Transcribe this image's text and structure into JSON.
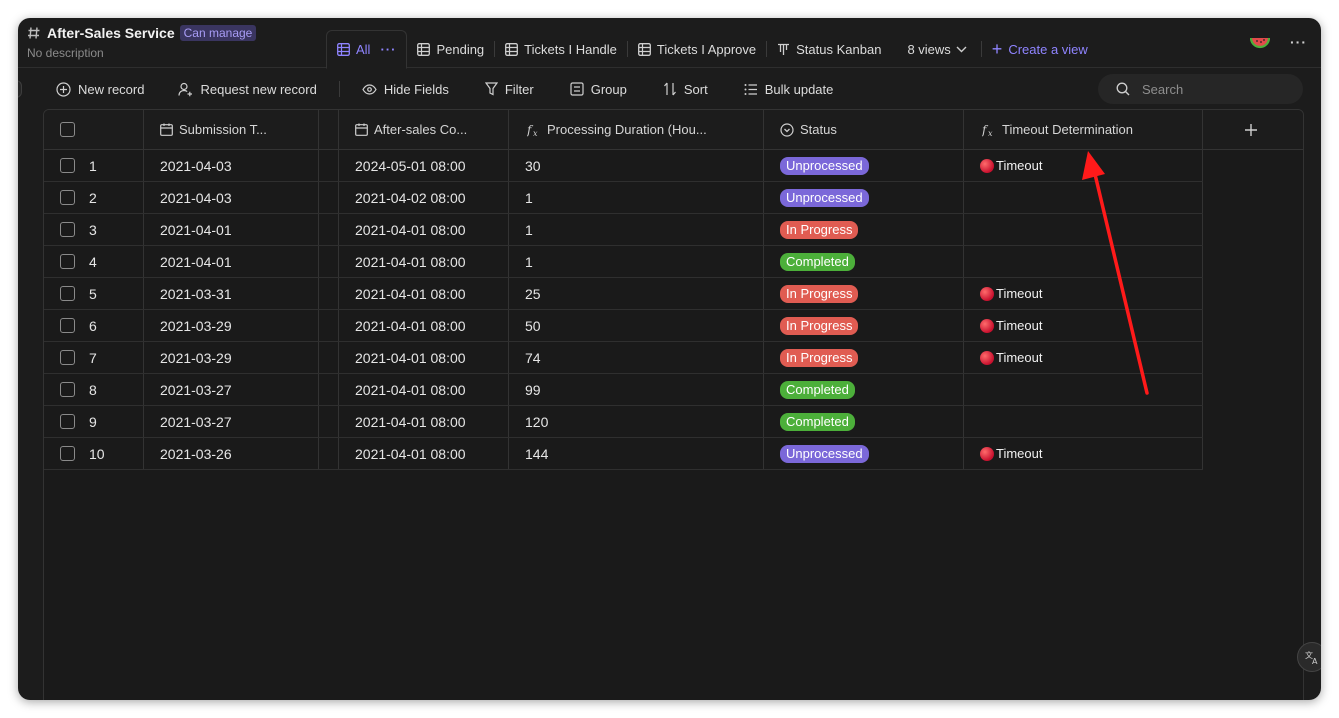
{
  "header": {
    "title": "After-Sales Service",
    "permission": "Can manage",
    "description": "No description"
  },
  "tabs": [
    {
      "label": "All",
      "icon": "grid-view-icon",
      "active": true
    },
    {
      "label": "Pending",
      "icon": "grid-view-icon"
    },
    {
      "label": "Tickets I Handle",
      "icon": "grid-view-icon"
    },
    {
      "label": "Tickets I Approve",
      "icon": "grid-view-icon"
    },
    {
      "label": "Status Kanban",
      "icon": "kanban-icon"
    }
  ],
  "views_dropdown": "8 views",
  "create_view": "Create a view",
  "toolbar": {
    "new_record": "New record",
    "request_new_record": "Request new record",
    "hide_fields": "Hide Fields",
    "filter": "Filter",
    "group": "Group",
    "sort": "Sort",
    "bulk_update": "Bulk update",
    "search_placeholder": "Search"
  },
  "columns": {
    "submission": "Submission T...",
    "after_sales": "After-sales Co...",
    "duration": "Processing Duration (Hou...",
    "status": "Status",
    "timeout": "Timeout Determination"
  },
  "colors": {
    "Unprocessed": "#7b68d9",
    "In Progress": "#e05c52",
    "Completed": "#4caf3a",
    "accent": "#8f84ff"
  },
  "rows": [
    {
      "n": "1",
      "submission": "2021-04-03",
      "after_sales": "2024-05-01 08:00",
      "duration": "30",
      "status": "Unprocessed",
      "timeout": "Timeout"
    },
    {
      "n": "2",
      "submission": "2021-04-03",
      "after_sales": "2021-04-02 08:00",
      "duration": "1",
      "status": "Unprocessed",
      "timeout": ""
    },
    {
      "n": "3",
      "submission": "2021-04-01",
      "after_sales": "2021-04-01 08:00",
      "duration": "1",
      "status": "In Progress",
      "timeout": ""
    },
    {
      "n": "4",
      "submission": "2021-04-01",
      "after_sales": "2021-04-01 08:00",
      "duration": "1",
      "status": "Completed",
      "timeout": ""
    },
    {
      "n": "5",
      "submission": "2021-03-31",
      "after_sales": "2021-04-01 08:00",
      "duration": "25",
      "status": "In Progress",
      "timeout": "Timeout"
    },
    {
      "n": "6",
      "submission": "2021-03-29",
      "after_sales": "2021-04-01 08:00",
      "duration": "50",
      "status": "In Progress",
      "timeout": "Timeout"
    },
    {
      "n": "7",
      "submission": "2021-03-29",
      "after_sales": "2021-04-01 08:00",
      "duration": "74",
      "status": "In Progress",
      "timeout": "Timeout"
    },
    {
      "n": "8",
      "submission": "2021-03-27",
      "after_sales": "2021-04-01 08:00",
      "duration": "99",
      "status": "Completed",
      "timeout": ""
    },
    {
      "n": "9",
      "submission": "2021-03-27",
      "after_sales": "2021-04-01 08:00",
      "duration": "120",
      "status": "Completed",
      "timeout": ""
    },
    {
      "n": "10",
      "submission": "2021-03-26",
      "after_sales": "2021-04-01 08:00",
      "duration": "144",
      "status": "Unprocessed",
      "timeout": "Timeout"
    }
  ]
}
